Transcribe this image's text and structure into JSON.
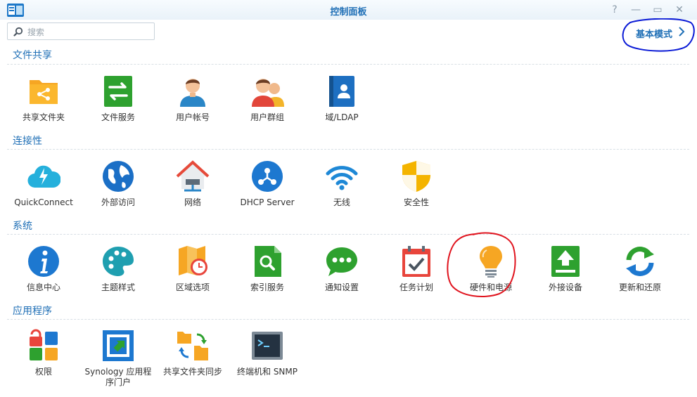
{
  "window": {
    "title": "控制面板",
    "buttons": {
      "help": "?",
      "minimize": "—",
      "maximize": "▭",
      "close": "✕"
    }
  },
  "search": {
    "placeholder": "搜索",
    "value": ""
  },
  "header": {
    "basic_mode_label": "基本模式"
  },
  "colors": {
    "accent": "#1f6fb6",
    "annotation_blue": "#0a1ad6",
    "annotation_red": "#e0141e"
  },
  "sections": [
    {
      "title": "文件共享",
      "items": [
        {
          "label": "共享文件夹",
          "icon": "shared-folder-icon"
        },
        {
          "label": "文件服务",
          "icon": "file-services-icon"
        },
        {
          "label": "用户帐号",
          "icon": "user-icon"
        },
        {
          "label": "用户群组",
          "icon": "group-icon"
        },
        {
          "label": "域/LDAP",
          "icon": "domain-ldap-icon"
        }
      ]
    },
    {
      "title": "连接性",
      "items": [
        {
          "label": "QuickConnect",
          "icon": "quickconnect-cloud-icon"
        },
        {
          "label": "外部访问",
          "icon": "globe-icon"
        },
        {
          "label": "网络",
          "icon": "network-house-icon"
        },
        {
          "label": "DHCP Server",
          "icon": "dhcp-server-icon"
        },
        {
          "label": "无线",
          "icon": "wifi-icon"
        },
        {
          "label": "安全性",
          "icon": "security-shield-icon"
        }
      ]
    },
    {
      "title": "系统",
      "items": [
        {
          "label": "信息中心",
          "icon": "info-icon"
        },
        {
          "label": "主题样式",
          "icon": "theme-palette-icon"
        },
        {
          "label": "区域选项",
          "icon": "regional-map-clock-icon"
        },
        {
          "label": "索引服务",
          "icon": "indexing-search-icon"
        },
        {
          "label": "通知设置",
          "icon": "notification-chat-icon"
        },
        {
          "label": "任务计划",
          "icon": "task-scheduler-calendar-icon"
        },
        {
          "label": "硬件和电源",
          "icon": "hardware-power-bulb-icon"
        },
        {
          "label": "外接设备",
          "icon": "external-devices-icon"
        },
        {
          "label": "更新和还原",
          "icon": "update-restore-icon"
        }
      ]
    },
    {
      "title": "应用程序",
      "items": [
        {
          "label": "权限",
          "icon": "privileges-icon"
        },
        {
          "label": "Synology 应用程\n序门户",
          "icon": "application-portal-icon"
        },
        {
          "label": "共享文件夹同步",
          "icon": "shared-folder-sync-icon"
        },
        {
          "label": "终端机和 SNMP",
          "icon": "terminal-snmp-icon"
        }
      ]
    }
  ]
}
